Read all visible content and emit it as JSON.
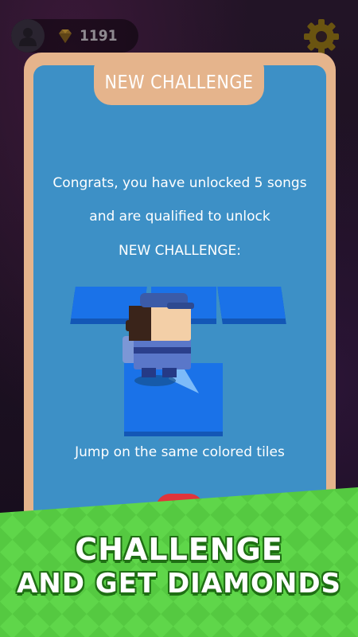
{
  "hud": {
    "diamonds": "1191",
    "avatar_icon": "user-icon",
    "settings_icon": "gear-icon"
  },
  "dialog": {
    "title": "NEW CHALLENGE",
    "message_line1": "Congrats, you have unlocked 5 songs",
    "message_line2": "and are qualified to unlock",
    "message_line3": "NEW CHALLENGE:",
    "caption": "Jump on the same colored tiles"
  },
  "banner": {
    "line1": "CHALLENGE",
    "line2": "AND GET DIAMONDS"
  },
  "colors": {
    "dialog_frame": "#e5b48c",
    "dialog_panel": "#3d90c6",
    "tile": "#1a72e8",
    "banner_green": "#5fd64a",
    "banner_outline": "#1f6f14"
  }
}
